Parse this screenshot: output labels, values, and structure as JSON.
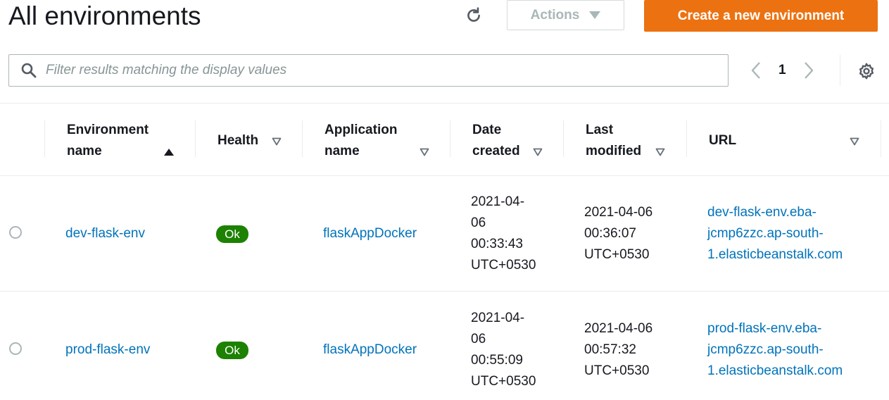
{
  "header": {
    "title": "All environments",
    "actions_label": "Actions",
    "create_label": "Create a new environment"
  },
  "search": {
    "placeholder": "Filter results matching the display values",
    "value": ""
  },
  "pagination": {
    "current_page": "1"
  },
  "columns": {
    "env_name_line1": "Environment",
    "env_name_line2": "name",
    "health": "Health",
    "app_name_line1": "Application",
    "app_name_line2": "name",
    "date_created_line1": "Date",
    "date_created_line2": "created",
    "last_modified_line1": "Last",
    "last_modified_line2": "modified",
    "url": "URL"
  },
  "rows": [
    {
      "environment_name": "dev-flask-env",
      "health": "Ok",
      "application_name": "flaskAppDocker",
      "date_created": [
        "2021-04-",
        "06",
        "00:33:43",
        "UTC+0530"
      ],
      "last_modified": [
        "2021-04-06",
        "00:36:07",
        "UTC+0530"
      ],
      "url": [
        "dev-flask-env.eba-",
        "jcmp6zzc.ap-south-",
        "1.elasticbeanstalk.com"
      ]
    },
    {
      "environment_name": "prod-flask-env",
      "health": "Ok",
      "application_name": "flaskAppDocker",
      "date_created": [
        "2021-04-",
        "06",
        "00:55:09",
        "UTC+0530"
      ],
      "last_modified": [
        "2021-04-06",
        "00:57:32",
        "UTC+0530"
      ],
      "url": [
        "prod-flask-env.eba-",
        "jcmp6zzc.ap-south-",
        "1.elasticbeanstalk.com"
      ]
    }
  ],
  "colors": {
    "primary_button": "#ec7211",
    "link": "#0073bb",
    "health_ok": "#1d8102",
    "border": "#aab7b8",
    "text": "#16191f"
  },
  "icons": {
    "refresh": "refresh-icon",
    "caret": "caret-down-icon",
    "search": "search-icon",
    "prev": "chevron-left-icon",
    "next": "chevron-right-icon",
    "settings": "gear-icon",
    "sort_asc": "sort-ascending-icon",
    "sort": "sort-icon"
  }
}
